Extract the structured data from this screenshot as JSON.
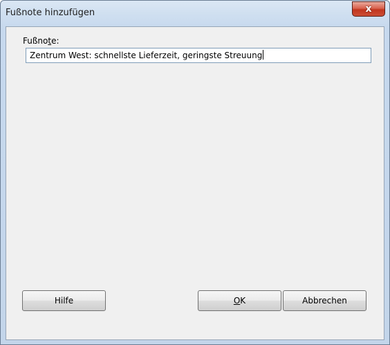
{
  "window": {
    "title": "Fußnote hinzufügen",
    "close_symbol": "x"
  },
  "form": {
    "label_pre": "Fußno",
    "label_accel": "t",
    "label_post": "e:",
    "input_value": "Zentrum West: schnellste Lieferzeit, geringste Streuung"
  },
  "buttons": {
    "help": "Hilfe",
    "ok_accel": "O",
    "ok_rest": "K",
    "cancel": "Abbrechen"
  },
  "icons": {
    "close": "close-icon"
  },
  "colors": {
    "close_button": "#c1361f",
    "client_background": "#f0f0f0",
    "frame": "#c7d9ee"
  }
}
